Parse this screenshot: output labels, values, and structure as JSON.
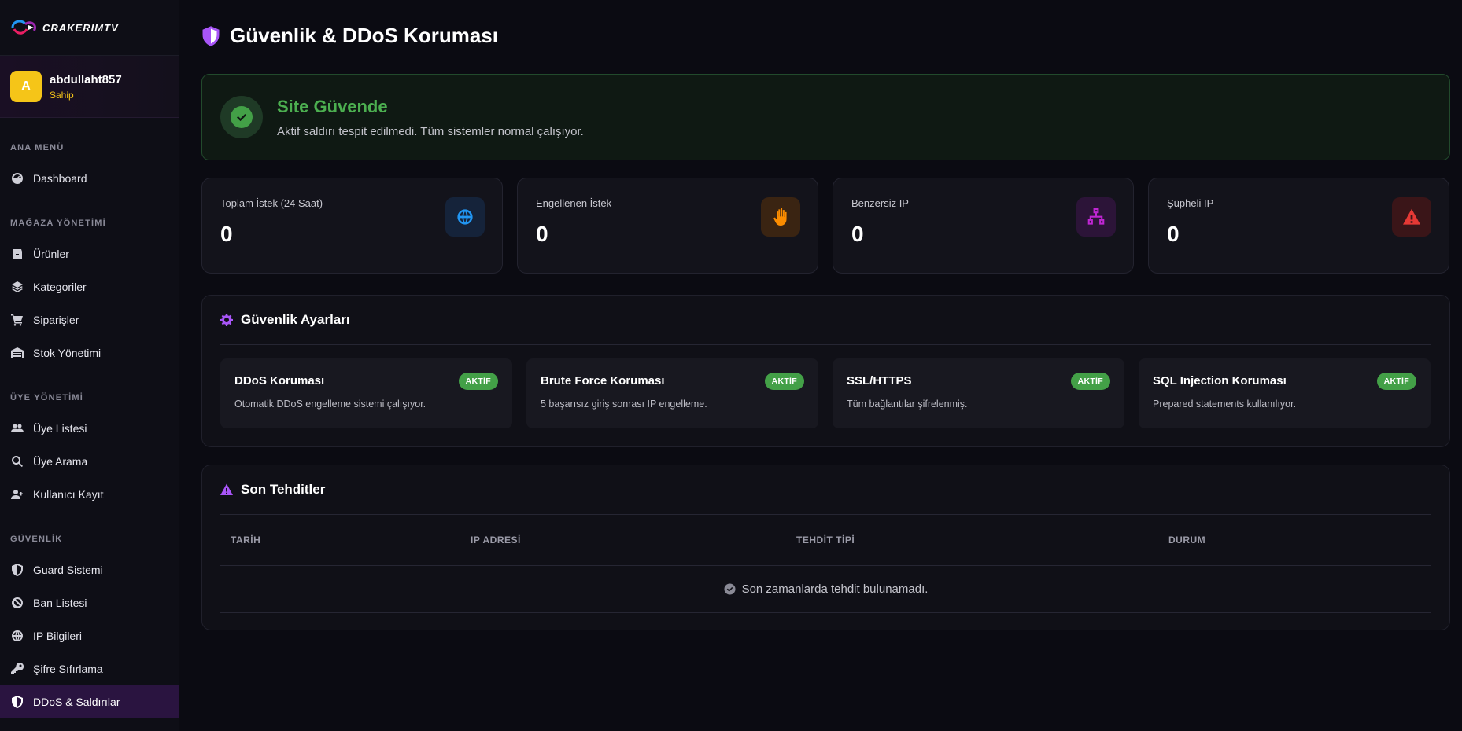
{
  "brand": {
    "name": "CRAKERIMTV"
  },
  "user": {
    "initial": "A",
    "name": "abdullaht857",
    "role": "Sahip"
  },
  "sidebar": {
    "sections": [
      {
        "title": "ANA MENÜ",
        "items": [
          {
            "label": "Dashboard",
            "icon": "gauge-icon"
          }
        ]
      },
      {
        "title": "MAĞAZA YÖNETİMİ",
        "items": [
          {
            "label": "Ürünler",
            "icon": "box-icon"
          },
          {
            "label": "Kategoriler",
            "icon": "layers-icon"
          },
          {
            "label": "Siparişler",
            "icon": "cart-icon"
          },
          {
            "label": "Stok Yönetimi",
            "icon": "warehouse-icon"
          }
        ]
      },
      {
        "title": "ÜYE YÖNETİMİ",
        "items": [
          {
            "label": "Üye Listesi",
            "icon": "users-icon"
          },
          {
            "label": "Üye Arama",
            "icon": "search-icon"
          },
          {
            "label": "Kullanıcı Kayıt",
            "icon": "user-plus-icon"
          }
        ]
      },
      {
        "title": "GÜVENLİK",
        "items": [
          {
            "label": "Guard Sistemi",
            "icon": "shield-icon"
          },
          {
            "label": "Ban Listesi",
            "icon": "ban-icon"
          },
          {
            "label": "IP Bilgileri",
            "icon": "globe-icon"
          },
          {
            "label": "Şifre Sıfırlama",
            "icon": "key-icon"
          },
          {
            "label": "DDoS & Saldırılar",
            "icon": "shield-icon",
            "active": true
          }
        ]
      }
    ]
  },
  "page": {
    "title": "Güvenlik & DDoS Koruması"
  },
  "status": {
    "title": "Site Güvende",
    "description": "Aktif saldırı tespit edilmedi. Tüm sistemler normal çalışıyor.",
    "color": "#4caf50"
  },
  "stats": [
    {
      "label": "Toplam İstek (24 Saat)",
      "value": "0",
      "icon": "globe-icon",
      "color": "#1e88e5"
    },
    {
      "label": "Engellenen İstek",
      "value": "0",
      "icon": "hand-icon",
      "color": "#fb8c00"
    },
    {
      "label": "Benzersiz IP",
      "value": "0",
      "icon": "network-icon",
      "color": "#c026d3"
    },
    {
      "label": "Şüpheli IP",
      "value": "0",
      "icon": "warning-icon",
      "color": "#e53935"
    }
  ],
  "settings": {
    "title": "Güvenlik Ayarları",
    "items": [
      {
        "title": "DDoS Koruması",
        "description": "Otomatik DDoS engelleme sistemi çalışıyor.",
        "badge": "AKTİF"
      },
      {
        "title": "Brute Force Koruması",
        "description": "5 başarısız giriş sonrası IP engelleme.",
        "badge": "AKTİF"
      },
      {
        "title": "SSL/HTTPS",
        "description": "Tüm bağlantılar şifrelenmiş.",
        "badge": "AKTİF"
      },
      {
        "title": "SQL Injection Koruması",
        "description": "Prepared statements kullanılıyor.",
        "badge": "AKTİF"
      }
    ]
  },
  "threats": {
    "title": "Son Tehditler",
    "columns": [
      "TARİH",
      "IP ADRESİ",
      "TEHDİT TİPİ",
      "DURUM"
    ],
    "empty_message": "Son zamanlarda tehdit bulunamadı."
  },
  "colors": {
    "accent": "#a855f7",
    "success": "#43a047",
    "background": "#0b0b12"
  }
}
